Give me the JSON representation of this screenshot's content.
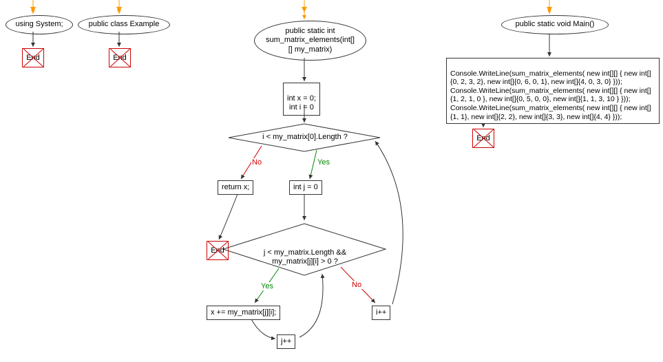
{
  "domain": "Diagram",
  "flowchart": {
    "nodes": {
      "using_system": {
        "label": "using System;"
      },
      "public_class": {
        "label": "public class Example"
      },
      "fn_header": {
        "label": "public static int\nsum_matrix_elements(int[]\n[] my_matrix)"
      },
      "init_vars": {
        "label": "int x = 0;\nint i = 0"
      },
      "cond_outer": {
        "label": "i < my_matrix[0].Length ?"
      },
      "return_x": {
        "label": "return x;"
      },
      "init_j": {
        "label": "int j = 0"
      },
      "cond_inner": {
        "label": "j < my_matrix.Length &&\nmy_matrix[j][i] > 0 ?"
      },
      "accum": {
        "label": "x += my_matrix[j][i];"
      },
      "jpp": {
        "label": "j++"
      },
      "ipp": {
        "label": "i++"
      },
      "main_header": {
        "label": "public static void Main()"
      },
      "main_body": {
        "label": "Console.WriteLine(sum_matrix_elements( new int[][] { new int[]{0, 2, 3, 2}, new int[]{0, 6, 0, 1}, new int[]{4, 0, 3, 0} }));\nConsole.WriteLine(sum_matrix_elements( new int[][] { new int[]{1, 2, 1, 0 }, new int[]{0, 5, 0, 0}, new int[]{1, 1, 3, 10 } }));\nConsole.WriteLine(sum_matrix_elements( new int[][] { new int[]{1, 1}, new int[]{2, 2}, new int[]{3, 3}, new int[]{4, 4} }));"
      },
      "end": {
        "label": "End"
      }
    },
    "edge_labels": {
      "yes": "Yes",
      "no": "No"
    }
  },
  "chart_data": {
    "type": "flowchart",
    "nodes": [
      {
        "id": "start1",
        "type": "start",
        "label": ""
      },
      {
        "id": "using",
        "type": "ellipse",
        "label": "using System;"
      },
      {
        "id": "end1",
        "type": "end",
        "label": "End"
      },
      {
        "id": "start2",
        "type": "start",
        "label": ""
      },
      {
        "id": "class",
        "type": "ellipse",
        "label": "public class Example"
      },
      {
        "id": "end2",
        "type": "end",
        "label": "End"
      },
      {
        "id": "start3",
        "type": "start",
        "label": ""
      },
      {
        "id": "fn",
        "type": "ellipse",
        "label": "public static int sum_matrix_elements(int[][] my_matrix)"
      },
      {
        "id": "init",
        "type": "process",
        "label": "int x = 0; int i = 0"
      },
      {
        "id": "cond_i",
        "type": "decision",
        "label": "i < my_matrix[0].Length ?"
      },
      {
        "id": "ret",
        "type": "process",
        "label": "return x;"
      },
      {
        "id": "end3",
        "type": "end",
        "label": "End"
      },
      {
        "id": "initj",
        "type": "process",
        "label": "int j = 0"
      },
      {
        "id": "cond_j",
        "type": "decision",
        "label": "j < my_matrix.Length && my_matrix[j][i] > 0 ?"
      },
      {
        "id": "accum",
        "type": "process",
        "label": "x += my_matrix[j][i];"
      },
      {
        "id": "jpp",
        "type": "process",
        "label": "j++"
      },
      {
        "id": "ipp",
        "type": "process",
        "label": "i++"
      },
      {
        "id": "start4",
        "type": "start",
        "label": ""
      },
      {
        "id": "main",
        "type": "ellipse",
        "label": "public static void Main()"
      },
      {
        "id": "body",
        "type": "process",
        "label": "Console.WriteLine(sum_matrix_elements( new int[][] { new int[]{0, 2, 3, 2}, new int[]{0, 6, 0, 1}, new int[]{4, 0, 3, 0} })); Console.WriteLine(sum_matrix_elements( new int[][] { new int[]{1, 2, 1, 0 }, new int[]{0, 5, 0, 0}, new int[]{1, 1, 3, 10 } })); Console.WriteLine(sum_matrix_elements( new int[][] { new int[]{1, 1}, new int[]{2, 2}, new int[]{3, 3}, new int[]{4, 4} }));"
      },
      {
        "id": "end4",
        "type": "end",
        "label": "End"
      }
    ],
    "edges": [
      {
        "from": "start1",
        "to": "using"
      },
      {
        "from": "using",
        "to": "end1"
      },
      {
        "from": "start2",
        "to": "class"
      },
      {
        "from": "class",
        "to": "end2"
      },
      {
        "from": "start3",
        "to": "fn"
      },
      {
        "from": "fn",
        "to": "init"
      },
      {
        "from": "init",
        "to": "cond_i"
      },
      {
        "from": "cond_i",
        "to": "ret",
        "label": "No"
      },
      {
        "from": "cond_i",
        "to": "initj",
        "label": "Yes"
      },
      {
        "from": "ret",
        "to": "end3"
      },
      {
        "from": "initj",
        "to": "cond_j"
      },
      {
        "from": "cond_j",
        "to": "accum",
        "label": "Yes"
      },
      {
        "from": "cond_j",
        "to": "ipp",
        "label": "No"
      },
      {
        "from": "accum",
        "to": "jpp"
      },
      {
        "from": "jpp",
        "to": "cond_j"
      },
      {
        "from": "ipp",
        "to": "cond_i"
      },
      {
        "from": "start4",
        "to": "main"
      },
      {
        "from": "main",
        "to": "body"
      },
      {
        "from": "body",
        "to": "end4"
      }
    ]
  }
}
